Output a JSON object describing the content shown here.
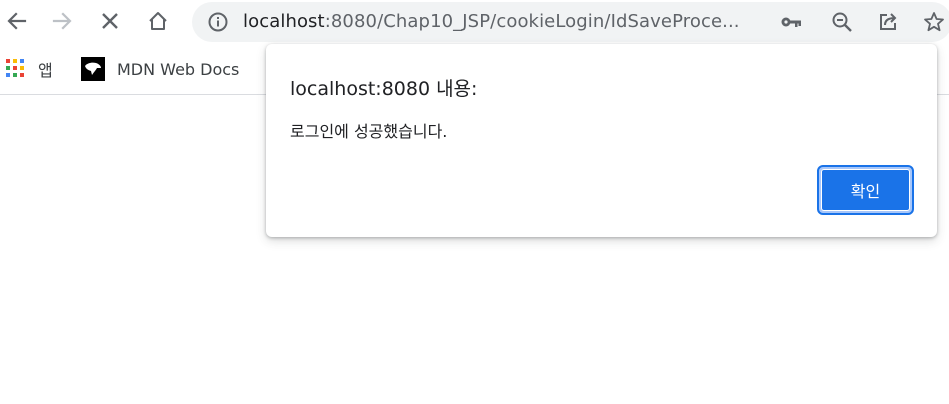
{
  "browser": {
    "url_host": "localhost",
    "url_path": ":8080/Chap10_JSP/cookieLogin/IdSaveProce...",
    "icons": {
      "back": "arrow-left-icon",
      "forward": "arrow-right-icon",
      "stop": "close-icon",
      "home": "home-icon",
      "site_info": "info-icon",
      "passwords": "key-icon",
      "zoom": "zoom-out-icon",
      "share": "share-icon",
      "bookmark": "star-icon"
    }
  },
  "bookmarks": {
    "apps_label": "앱",
    "items": [
      {
        "label": "MDN Web Docs"
      }
    ]
  },
  "dialog": {
    "title": "localhost:8080 내용:",
    "message": "로그인에 성공했습니다.",
    "ok_label": "확인"
  },
  "colors": {
    "accent": "#1a73e8",
    "omnibox_bg": "#f1f3f4",
    "text": "#202124",
    "icon": "#5f6368"
  }
}
